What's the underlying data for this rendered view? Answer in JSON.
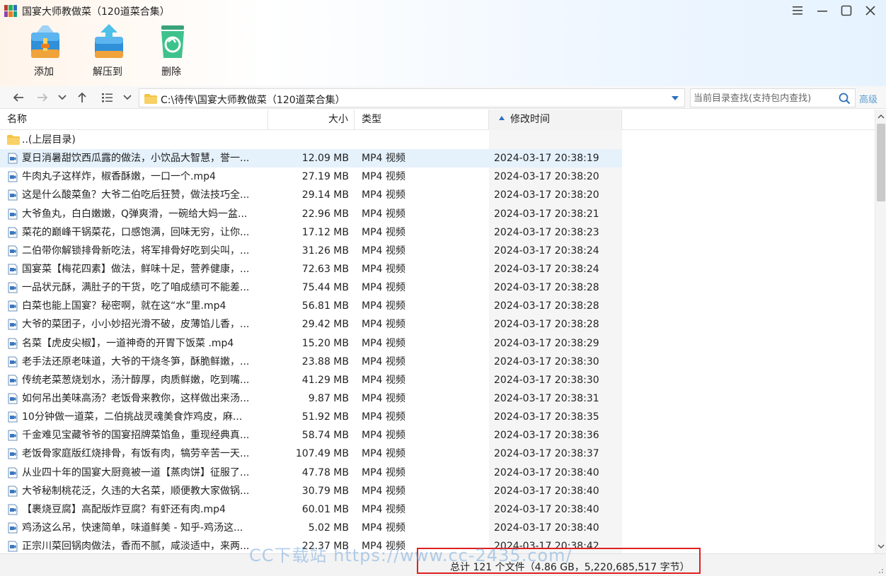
{
  "window": {
    "title": "国宴大师教做菜（120道菜合集）",
    "controls": [
      "menu-icon",
      "minimize-icon",
      "maximize-icon",
      "close-icon"
    ]
  },
  "toolbar": {
    "add_label": "添加",
    "extract_label": "解压到",
    "delete_label": "删除"
  },
  "nav": {
    "path": "C:\\待传\\国宴大师教做菜（120道菜合集）",
    "search_placeholder": "当前目录查找(支持包内查找)",
    "advanced_label": "高级"
  },
  "columns": {
    "name": "名称",
    "size": "大小",
    "type": "类型",
    "mtime": "修改时间"
  },
  "parent_dir": "..(上层目录)",
  "files": [
    {
      "name": "夏日消暑甜饮西瓜露的做法，小饮品大智慧，誉一...",
      "size": "12.09 MB",
      "type": "MP4 视频",
      "mtime": "2024-03-17 20:38:19"
    },
    {
      "name": "牛肉丸子这样炸，椒香酥嫩，一口一个.mp4",
      "size": "27.19 MB",
      "type": "MP4 视频",
      "mtime": "2024-03-17 20:38:20"
    },
    {
      "name": "这是什么酸菜鱼？大爷二伯吃后狂赞，做法技巧全...",
      "size": "29.14 MB",
      "type": "MP4 视频",
      "mtime": "2024-03-17 20:38:20"
    },
    {
      "name": "大爷鱼丸，白白嫩嫩，Q弹爽滑，一碗给大妈一盆...",
      "size": "22.96 MB",
      "type": "MP4 视频",
      "mtime": "2024-03-17 20:38:21"
    },
    {
      "name": "菜花的巅峰干锅菜花，口感饱满，回味无穷，让你...",
      "size": "17.12 MB",
      "type": "MP4 视频",
      "mtime": "2024-03-17 20:38:23"
    },
    {
      "name": "二伯带你解锁排骨新吃法，将军排骨好吃到尖叫，...",
      "size": "31.26 MB",
      "type": "MP4 视频",
      "mtime": "2024-03-17 20:38:24"
    },
    {
      "name": "国宴菜【梅花四素】做法，鲜味十足，营养健康，...",
      "size": "72.63 MB",
      "type": "MP4 视频",
      "mtime": "2024-03-17 20:38:24"
    },
    {
      "name": "一品状元酥，满肚子的干货，吃了咱成绩可不能差...",
      "size": "75.44 MB",
      "type": "MP4 视频",
      "mtime": "2024-03-17 20:38:28"
    },
    {
      "name": "白菜也能上国宴？秘密啊，就在这“水”里.mp4",
      "size": "56.81 MB",
      "type": "MP4 视频",
      "mtime": "2024-03-17 20:38:28"
    },
    {
      "name": "大爷的菜团子，小小妙招光滑不破，皮薄馅儿香，...",
      "size": "29.42 MB",
      "type": "MP4 视频",
      "mtime": "2024-03-17 20:38:28"
    },
    {
      "name": "名菜【虎皮尖椒】，一道神奇的开胃下饭菜 .mp4",
      "size": "15.20 MB",
      "type": "MP4 视频",
      "mtime": "2024-03-17 20:38:29"
    },
    {
      "name": "老手法还原老味道，大爷的干烧冬笋，酥脆鲜嫩，...",
      "size": "23.88 MB",
      "type": "MP4 视频",
      "mtime": "2024-03-17 20:38:30"
    },
    {
      "name": "传统老菜葱烧划水，汤汁醇厚，肉质鲜嫩，吃到嘴...",
      "size": "41.29 MB",
      "type": "MP4 视频",
      "mtime": "2024-03-17 20:38:30"
    },
    {
      "name": "如何吊出美味高汤？老饭骨来教你，这样做出来汤...",
      "size": "9.87 MB",
      "type": "MP4 视频",
      "mtime": "2024-03-17 20:38:31"
    },
    {
      "name": "10分钟做一道菜，二伯挑战灵魂美食炸鸡皮，麻...",
      "size": "51.92 MB",
      "type": "MP4 视频",
      "mtime": "2024-03-17 20:38:35"
    },
    {
      "name": "千金难见宝藏爷爷的国宴招牌菜馅鱼，重现经典真...",
      "size": "58.74 MB",
      "type": "MP4 视频",
      "mtime": "2024-03-17 20:38:36"
    },
    {
      "name": "老饭骨家庭版红烧排骨，有饭有肉，犒劳辛苦一天...",
      "size": "107.49 MB",
      "type": "MP4 视频",
      "mtime": "2024-03-17 20:38:37"
    },
    {
      "name": "从业四十年的国宴大厨竟被一道【蒸肉饼】征服了...",
      "size": "47.78 MB",
      "type": "MP4 视频",
      "mtime": "2024-03-17 20:38:40"
    },
    {
      "name": "大爷秘制桃花泛，久违的大名菜，顺便教大家做锅...",
      "size": "30.79 MB",
      "type": "MP4 视频",
      "mtime": "2024-03-17 20:38:40"
    },
    {
      "name": "【裹烧豆腐】高配版炸豆腐？有虾还有肉.mp4",
      "size": "60.01 MB",
      "type": "MP4 视频",
      "mtime": "2024-03-17 20:38:40"
    },
    {
      "name": "鸡汤这么吊，快速简单，味道鲜美 - 知乎-鸡汤这...",
      "size": "5.02 MB",
      "type": "MP4 视频",
      "mtime": "2024-03-17 20:38:40"
    },
    {
      "name": "正宗川菜回锅肉做法，香而不腻，咸淡适中，来两...",
      "size": "22.37 MB",
      "type": "MP4 视频",
      "mtime": "2024-03-17 20:38:42"
    }
  ],
  "status": {
    "summary": "总计 121 个文件（4.86 GB，5,220,685,517 字节）"
  },
  "watermark": "CC下载站 https://www.cc-2435.com/",
  "colors": {
    "accent": "#2c6fbd",
    "selected_row": "#e5f1fb",
    "highlight_box": "#e02020",
    "advanced_link": "#5a9fd4"
  }
}
